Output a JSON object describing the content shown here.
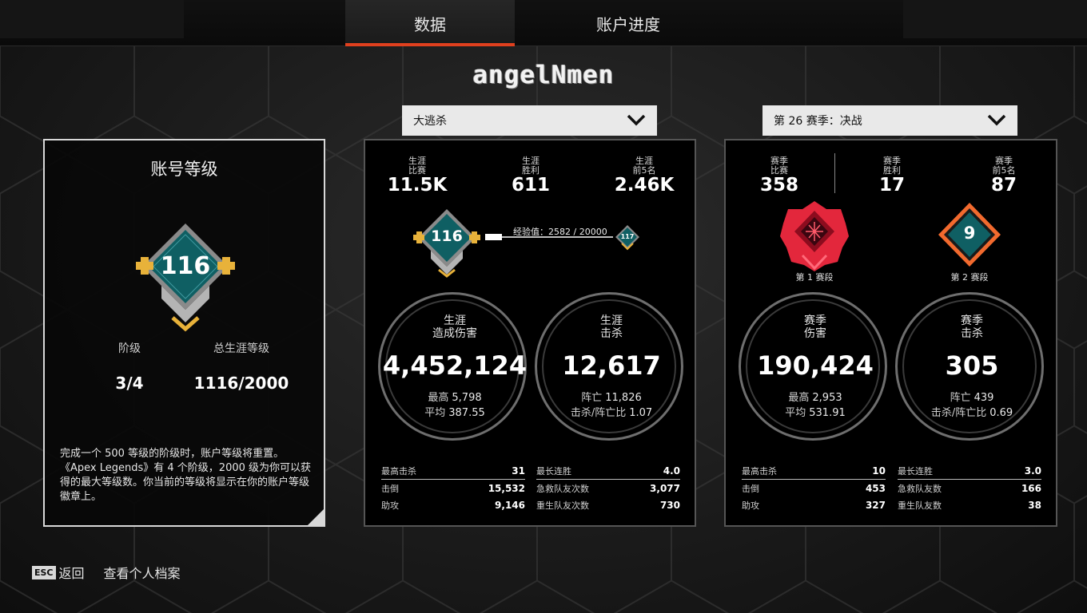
{
  "tabs": [
    {
      "label": "数据",
      "active": true
    },
    {
      "label": "账户进度",
      "active": false
    }
  ],
  "username": "angelNmen",
  "dropdowns": {
    "mode": "大逃杀",
    "season": "第 26 赛季：决战"
  },
  "account_level": {
    "title": "账号等级",
    "badge_level": "116",
    "tier_label": "阶级",
    "tier_value": "3/4",
    "total_label": "总生涯等级",
    "total_value": "1116/2000",
    "description": "完成一个 500 等级的阶级时，账户等级将重置。《Apex Legends》有 4 个阶级，2000 级为你可以获得的最大等级数。你当前的等级将显示在你的账户等级徽章上。"
  },
  "career": {
    "top_stats": [
      {
        "label1": "生涯",
        "label2": "比赛",
        "value": "11.5K"
      },
      {
        "label1": "生涯",
        "label2": "胜利",
        "value": "611"
      },
      {
        "label1": "生涯",
        "label2": "前5名",
        "value": "2.46K"
      }
    ],
    "current_level": "116",
    "next_level": "117",
    "xp_label": "经验值：",
    "xp_value": "2582 / 20000",
    "xp_progress": 0.129,
    "damage": {
      "title1": "生涯",
      "title2": "造成伤害",
      "value": "4,452,124",
      "sub1_label": "最高",
      "sub1_value": "5,798",
      "sub2_label": "平均",
      "sub2_value": "387.55"
    },
    "kills": {
      "title1": "生涯",
      "title2": "击杀",
      "value": "12,617",
      "sub1_label": "阵亡",
      "sub1_value": "11,826",
      "sub2_label": "击杀/阵亡比",
      "sub2_value": "1.07"
    },
    "stats_left": [
      {
        "label": "最高击杀",
        "value": "31"
      },
      {
        "label": "击倒",
        "value": "15,532"
      },
      {
        "label": "助攻",
        "value": "9,146"
      }
    ],
    "stats_right": [
      {
        "label": "最长连胜",
        "value": "4.0"
      },
      {
        "label": "急救队友次数",
        "value": "3,077"
      },
      {
        "label": "重生队友次数",
        "value": "730"
      }
    ]
  },
  "season": {
    "top_stats": [
      {
        "label1": "赛季",
        "label2": "比赛",
        "value": "358"
      },
      {
        "label1": "赛季",
        "label2": "胜利",
        "value": "17"
      },
      {
        "label1": "赛季",
        "label2": "前5名",
        "value": "87"
      }
    ],
    "split1_label": "第 1 赛段",
    "split2_label": "第 2 赛段",
    "split2_badge": "9",
    "damage": {
      "title1": "赛季",
      "title2": "伤害",
      "value": "190,424",
      "sub1_label": "最高",
      "sub1_value": "2,953",
      "sub2_label": "平均",
      "sub2_value": "531.91"
    },
    "kills": {
      "title1": "赛季",
      "title2": "击杀",
      "value": "305",
      "sub1_label": "阵亡",
      "sub1_value": "439",
      "sub2_label": "击杀/阵亡比",
      "sub2_value": "0.69"
    },
    "stats_left": [
      {
        "label": "最高击杀",
        "value": "10"
      },
      {
        "label": "击倒",
        "value": "453"
      },
      {
        "label": "助攻",
        "value": "327"
      }
    ],
    "stats_right": [
      {
        "label": "最长连胜",
        "value": "3.0"
      },
      {
        "label": "急救队友数",
        "value": "166"
      },
      {
        "label": "重生队友数",
        "value": "38"
      }
    ]
  },
  "footer": {
    "esc_key": "ESC",
    "back_label": "返回",
    "profile_label": "查看个人档案"
  },
  "colors": {
    "accent": "#e0401e",
    "badge_teal": "#0f5f63",
    "rank_red": "#e3273c",
    "rank_orange": "#f26a2e",
    "gold": "#e8b23a"
  },
  "icons": [
    "chevron-down-icon",
    "level-badge-icon",
    "ranked-badge-icon"
  ]
}
